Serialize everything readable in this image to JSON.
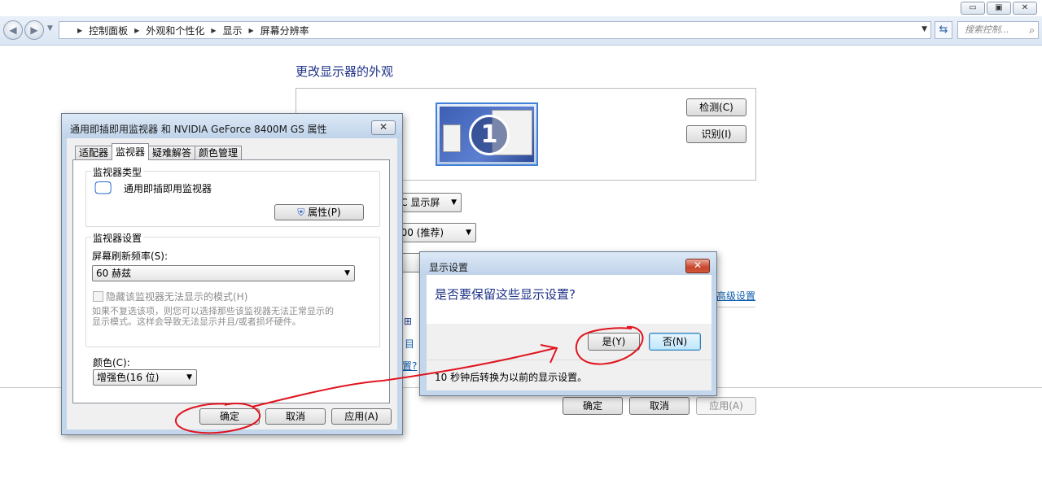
{
  "window": {
    "minimize": "▭",
    "restore": "▣",
    "close": "✕"
  },
  "address_bar": {
    "crumbs": [
      "控制面板",
      "外观和个性化",
      "显示",
      "屏幕分辨率"
    ],
    "search_placeholder": "搜索控制..."
  },
  "main": {
    "title": "更改显示器的外观",
    "monitor_number": "1",
    "detect_button": "检测(C)",
    "identify_button": "识别(I)",
    "display_combo": "PC 显示屏",
    "resolution_combo": "800 (推荐)",
    "advanced_link": "高级设置",
    "partial_link_1": "目",
    "partial_link_2": "置?",
    "ok_button": "确定",
    "cancel_button": "取消",
    "apply_button": "应用(A)"
  },
  "properties_dialog": {
    "title": "通用即插即用监视器 和 NVIDIA GeForce 8400M GS 属性",
    "tabs": [
      "适配器",
      "监视器",
      "疑难解答",
      "颜色管理"
    ],
    "active_tab": "监视器",
    "monitor_type_group": "监视器类型",
    "monitor_name": "通用即插即用监视器",
    "properties_button": "属性(P)",
    "monitor_settings_group": "监视器设置",
    "refresh_rate_label": "屏幕刷新频率(S):",
    "refresh_rate_value": "60 赫兹",
    "hide_modes_label": "隐藏该监视器无法显示的模式(H)",
    "hide_modes_desc_1": "如果不复选该项，则您可以选择那些该监视器无法正常显示的",
    "hide_modes_desc_2": "显示模式。这样会导致无法显示并且/或者损坏硬件。",
    "color_label": "颜色(C):",
    "color_value": "增强色(16 位)",
    "ok_button": "确定",
    "cancel_button": "取消",
    "apply_button": "应用(A)"
  },
  "confirm_dialog": {
    "title": "显示设置",
    "question": "是否要保留这些显示设置?",
    "yes_button": "是(Y)",
    "no_button": "否(N)",
    "countdown": "10 秒钟后转换为以前的显示设置。"
  },
  "colors": {
    "title_blue": "#1e3287",
    "link_blue": "#0b5cad",
    "annotation_red": "#e0141e"
  }
}
